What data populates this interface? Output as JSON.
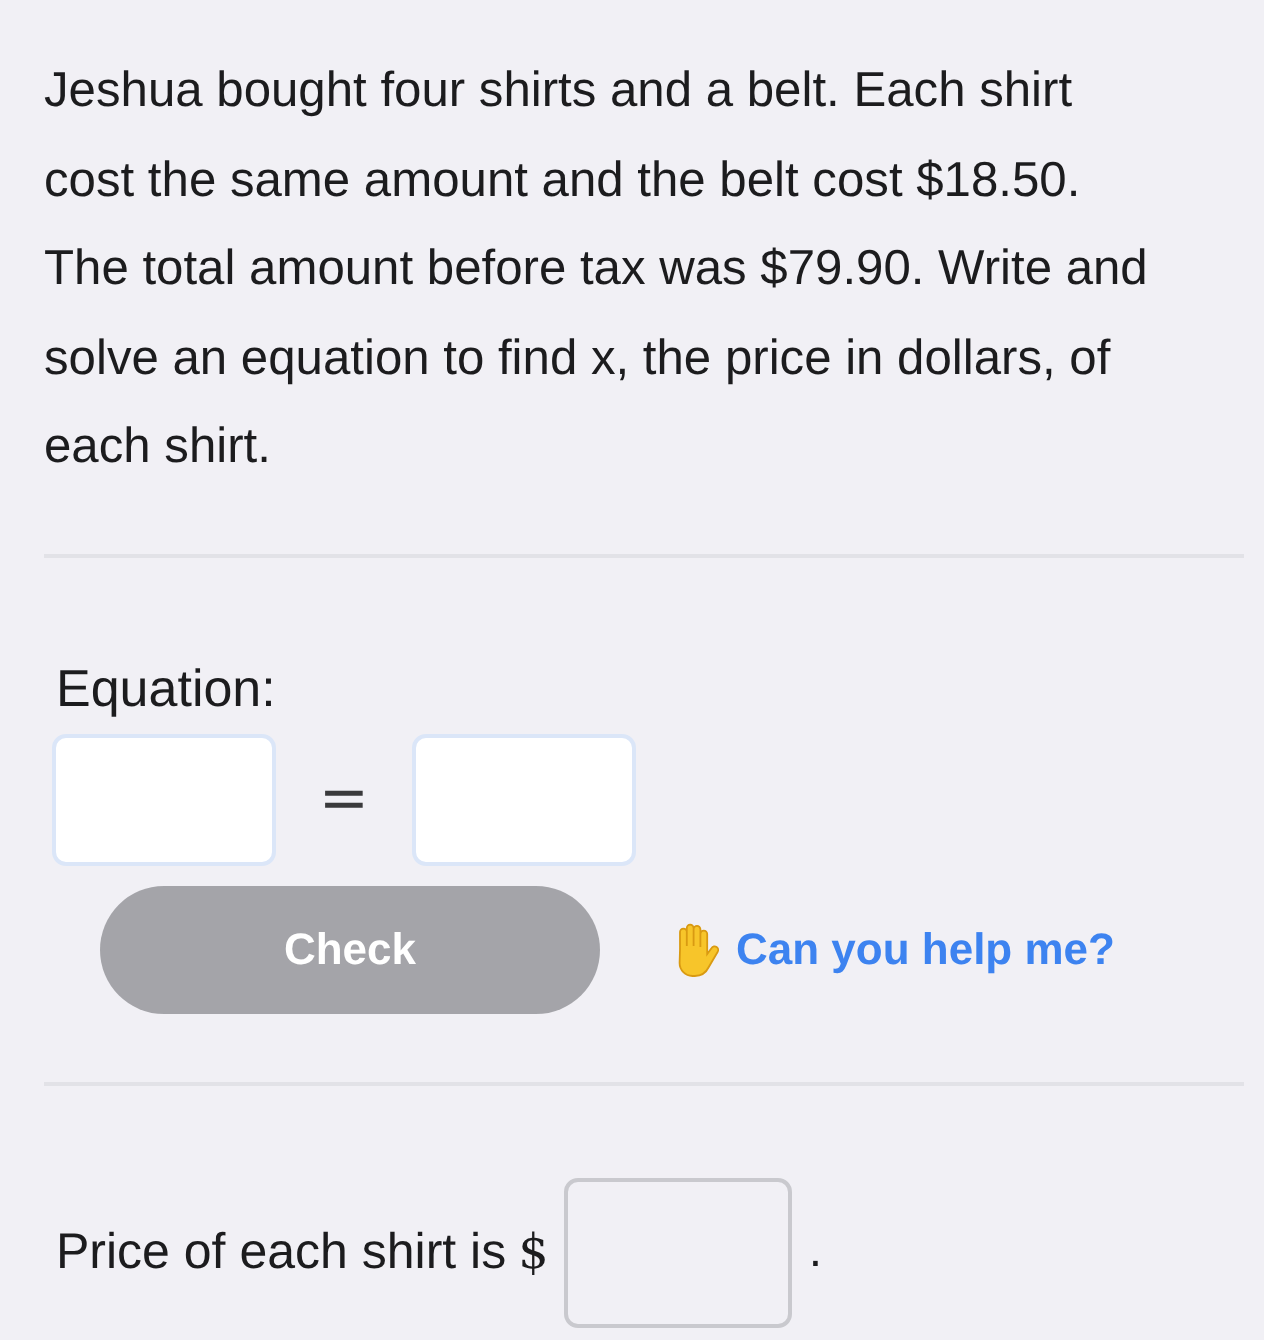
{
  "problem": {
    "text": "Jeshua bought four shirts and a belt. Each shirt cost the same amount and the belt cost $18.50. The total amount before tax was $79.90. Write and solve an equation to find x, the price in dollars, of each shirt."
  },
  "equation": {
    "label": "Equation:",
    "symbol": "="
  },
  "actions": {
    "check_button": {
      "label": "Check",
      "disabled": true
    },
    "help_link": {
      "label": "Can you help me?"
    }
  },
  "answer": {
    "prefix": "Price of each shirt is",
    "currency_symbol": "$",
    "suffix": "."
  }
}
